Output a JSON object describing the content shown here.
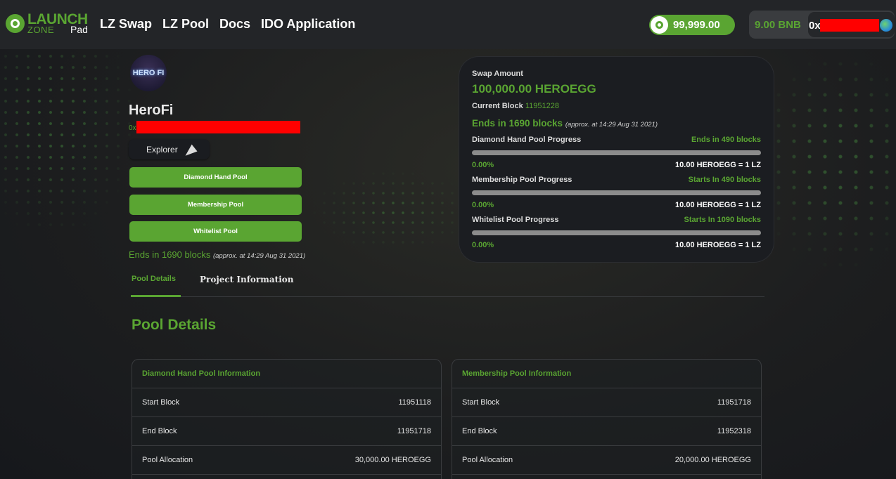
{
  "header": {
    "logo": {
      "launch": "LAUNCH",
      "zone": "ZONE",
      "pad": "Pad"
    },
    "nav": [
      "LZ Swap",
      "LZ Pool",
      "Docs",
      "IDO Application"
    ],
    "balance": "99,999.00",
    "wallet": {
      "bnb": "9.00 BNB",
      "address_prefix": "0x"
    }
  },
  "project": {
    "avatar_text": "HERO FI",
    "name": "HeroFi",
    "address_prefix": "0x",
    "explorer_label": "Explorer",
    "pool_buttons": [
      "Diamond Hand Pool",
      "Membership Pool",
      "Whitelist Pool"
    ],
    "ends_text": "Ends in 1690 blocks",
    "ends_approx": "(approx. at 14:29 Aug 31 2021)"
  },
  "swap": {
    "label": "Swap Amount",
    "amount": "100,000.00 HEROEGG",
    "current_block_label": "Current Block",
    "current_block": "11951228",
    "ends_text": "Ends in 1690 blocks",
    "ends_approx": "(approx. at 14:29 Aug 31 2021)",
    "pools": [
      {
        "name": "Diamond Hand Pool Progress",
        "status": "Ends in 490 blocks",
        "percent": "0.00%",
        "rate": "10.00 HEROEGG = 1 LZ"
      },
      {
        "name": "Membership Pool Progress",
        "status": "Starts In 490 blocks",
        "percent": "0.00%",
        "rate": "10.00 HEROEGG = 1 LZ"
      },
      {
        "name": "Whitelist Pool Progress",
        "status": "Starts In 1090 blocks",
        "percent": "0.00%",
        "rate": "10.00 HEROEGG = 1 LZ"
      }
    ]
  },
  "tabs": {
    "pool_details": "Pool Details",
    "project_info": "Project Information"
  },
  "section_title": "Pool Details",
  "info_tables": [
    {
      "title": "Diamond Hand Pool Information",
      "rows": [
        {
          "label": "Start Block",
          "value": "11951118"
        },
        {
          "label": "End Block",
          "value": "11951718"
        },
        {
          "label": "Pool Allocation",
          "value": "30,000.00 HEROEGG"
        }
      ]
    },
    {
      "title": "Membership Pool Information",
      "rows": [
        {
          "label": "Start Block",
          "value": "11951718"
        },
        {
          "label": "End Block",
          "value": "11952318"
        },
        {
          "label": "Pool Allocation",
          "value": "20,000.00 HEROEGG"
        }
      ]
    }
  ],
  "colors": {
    "accent": "#5aa532",
    "background": "#1d1e1f",
    "card": "#1b1d21",
    "redaction": "#ff0000"
  }
}
